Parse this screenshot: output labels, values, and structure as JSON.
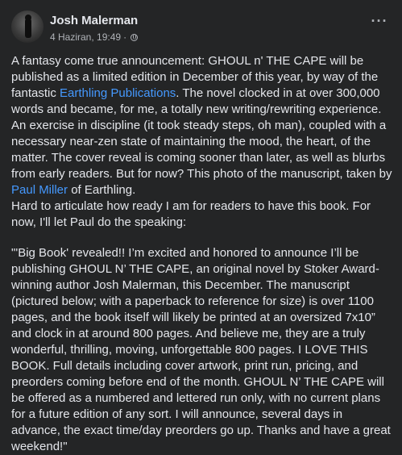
{
  "author": {
    "name": "Josh Malerman"
  },
  "meta": {
    "date": "4 Haziran, 19:49",
    "separator": "·"
  },
  "menu": {
    "more_label": "···"
  },
  "post": {
    "p1_a": "A fantasy come true announcement: GHOUL n' THE CAPE will be published as a limited edition in December of this year, by way of the fantastic ",
    "p1_link1": "Earthling Publications",
    "p1_b": ". The novel clocked in at over 300,000 words and became, for me, a totally new writing/rewriting experience. An exercise in discipline (it took steady steps, oh man), coupled with a necessary near-zen state of maintaining the mood, the heart, of the matter. The cover reveal is coming sooner than later, as well as blurbs from early readers. But for now? This photo of the manuscript, taken by ",
    "p1_link2": "Paul Miller",
    "p1_c": " of Earthling.",
    "p2": "Hard to articulate how ready I am for readers to have this book. For now, I'll let Paul do the speaking:",
    "p3": "\"'Big Book' revealed!! I’m excited and honored to announce I’ll be publishing GHOUL N’ THE CAPE, an original novel by Stoker Award-winning author Josh Malerman, this December. The manuscript (pictured below; with a paperback to reference for size) is over 1100 pages, and the book itself will likely be printed at an oversized 7x10” and clock in at around 800 pages. And believe me, they are a truly wonderful, thrilling, moving, unforgettable 800 pages. I LOVE THIS BOOK. Full details including cover artwork, print run, pricing, and preorders coming before end of the month. GHOUL N’ THE CAPE will be offered as a numbered and lettered run only, with no current plans for a future edition of any sort. I will announce, several days in advance, the exact time/day preorders go up. Thanks and have a great weekend!\""
  },
  "colors": {
    "background": "#242526",
    "text": "#e4e6eb",
    "secondary": "#b0b3b8",
    "link": "#4599ff"
  }
}
